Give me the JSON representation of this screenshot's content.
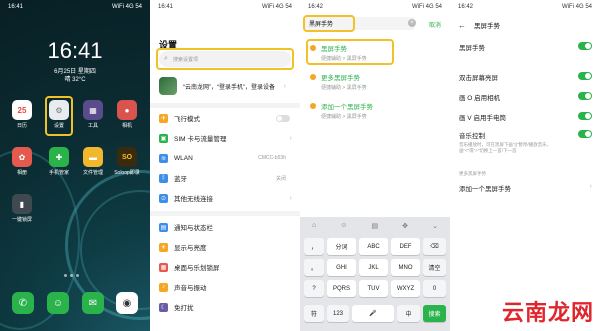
{
  "home": {
    "status_time": "16:41",
    "status_right": "WiFi 4G 54",
    "clock": "16:41",
    "date": "6月25日 星期四",
    "weather": "晴 32°C",
    "apps_row1": [
      {
        "label": "日历",
        "glyph": "25",
        "color": "#e74c3c"
      },
      {
        "label": "设置",
        "glyph": "⚙",
        "color": "#8f9aa0"
      },
      {
        "label": "工具",
        "glyph": "▦",
        "color": "#6b5ca5"
      },
      {
        "label": "相机",
        "glyph": "●",
        "color": "#d9534f"
      }
    ],
    "apps_row2": [
      {
        "label": "相册",
        "glyph": "✿",
        "color": "#e55a4e"
      },
      {
        "label": "手机管家",
        "glyph": "✚",
        "color": "#2ab24b"
      },
      {
        "label": "文件管理",
        "glyph": "▬",
        "color": "#f1b82d"
      },
      {
        "label": "Soloop即录",
        "glyph": "SO",
        "color": "#3a2a0e"
      }
    ],
    "app_row3": {
      "label": "一键锁屏",
      "glyph": "▮",
      "color": "#3e4a50"
    },
    "dock": [
      {
        "name": "phone",
        "glyph": "✆",
        "color": "#2ab24b"
      },
      {
        "name": "contacts",
        "glyph": "☺",
        "color": "#2ab24b"
      },
      {
        "name": "messages",
        "glyph": "✉",
        "color": "#2ab24b"
      },
      {
        "name": "camera",
        "glyph": "◉",
        "color": "#ffffff"
      }
    ]
  },
  "settings": {
    "status_time": "16:41",
    "status_right": "WiFi 4G 54",
    "title": "设置",
    "search_placeholder": "搜索设置项",
    "account_name": "“云南龙网”，“登录手机”，登录设备",
    "account_sub": "",
    "rows": [
      {
        "label": "飞行模式",
        "value": "",
        "icon_color": "#f5a623",
        "glyph": "✈"
      },
      {
        "label": "SIM 卡与流量管理",
        "value": "",
        "icon_color": "#2ab24b",
        "glyph": "▣"
      },
      {
        "label": "WLAN",
        "value": "CMCC-b53h",
        "icon_color": "#3d8ee6",
        "glyph": "≋"
      },
      {
        "label": "蓝牙",
        "value": "关闭",
        "icon_color": "#3d8ee6",
        "glyph": "ᛒ"
      },
      {
        "label": "其他无线连接",
        "value": "",
        "icon_color": "#3d8ee6",
        "glyph": "⊙"
      },
      {
        "label": "通知与状态栏",
        "value": "",
        "icon_color": "#3d8ee6",
        "glyph": "▤"
      },
      {
        "label": "显示与亮度",
        "value": "",
        "icon_color": "#f5a623",
        "glyph": "☀"
      },
      {
        "label": "桌面与乐划锁屏",
        "value": "",
        "icon_color": "#e55a4e",
        "glyph": "▦"
      },
      {
        "label": "声音与振动",
        "value": "",
        "icon_color": "#f5a623",
        "glyph": "♪"
      },
      {
        "label": "免打扰",
        "value": "",
        "icon_color": "#6b5ca5",
        "glyph": "☾"
      }
    ]
  },
  "search": {
    "status_time": "16:42",
    "status_right": "WiFi 4G 54",
    "query": "黑屏手势",
    "cancel": "取消",
    "results": [
      {
        "title": "黑屏手势",
        "path": "便捷辅助 > 黑屏手势"
      },
      {
        "title": "更多黑屏手势",
        "path": "便捷辅助 > 黑屏手势"
      },
      {
        "title": "添加一个黑屏手势",
        "path": "便捷辅助 > 黑屏手势"
      }
    ],
    "keyboard": {
      "row1": [
        "，",
        "分词",
        "ABC",
        "DEF",
        "⌫"
      ],
      "row2": [
        "。",
        "GHI",
        "JKL",
        "MNO",
        "清空"
      ],
      "row3": [
        "?",
        "PQRS",
        "TUV",
        "WXYZ",
        "0"
      ],
      "row4": [
        "!",
        "",
        "",
        "",
        ""
      ],
      "bottom": [
        "符",
        "123",
        "🎤",
        "中",
        "搜索"
      ]
    }
  },
  "gesture": {
    "status_time": "16:42",
    "status_right": "WiFi 4G 54",
    "header": "黑屏手势",
    "main_toggle": "黑屏手势",
    "items": [
      {
        "label": "双击屏幕亮屏",
        "on": true
      },
      {
        "label": "画 O 启用相机",
        "on": true
      },
      {
        "label": "画 V 启用手电筒",
        "on": true
      }
    ],
    "music_label": "音乐控制",
    "music_sub": "音乐播放时，可在黑屏下画“||”暂停/播放音乐，画“<”或“>”切换上一首/下一首",
    "more_section": "更多黑屏手势",
    "add_label": "添加一个黑屏手势"
  },
  "watermark": "云南龙网"
}
